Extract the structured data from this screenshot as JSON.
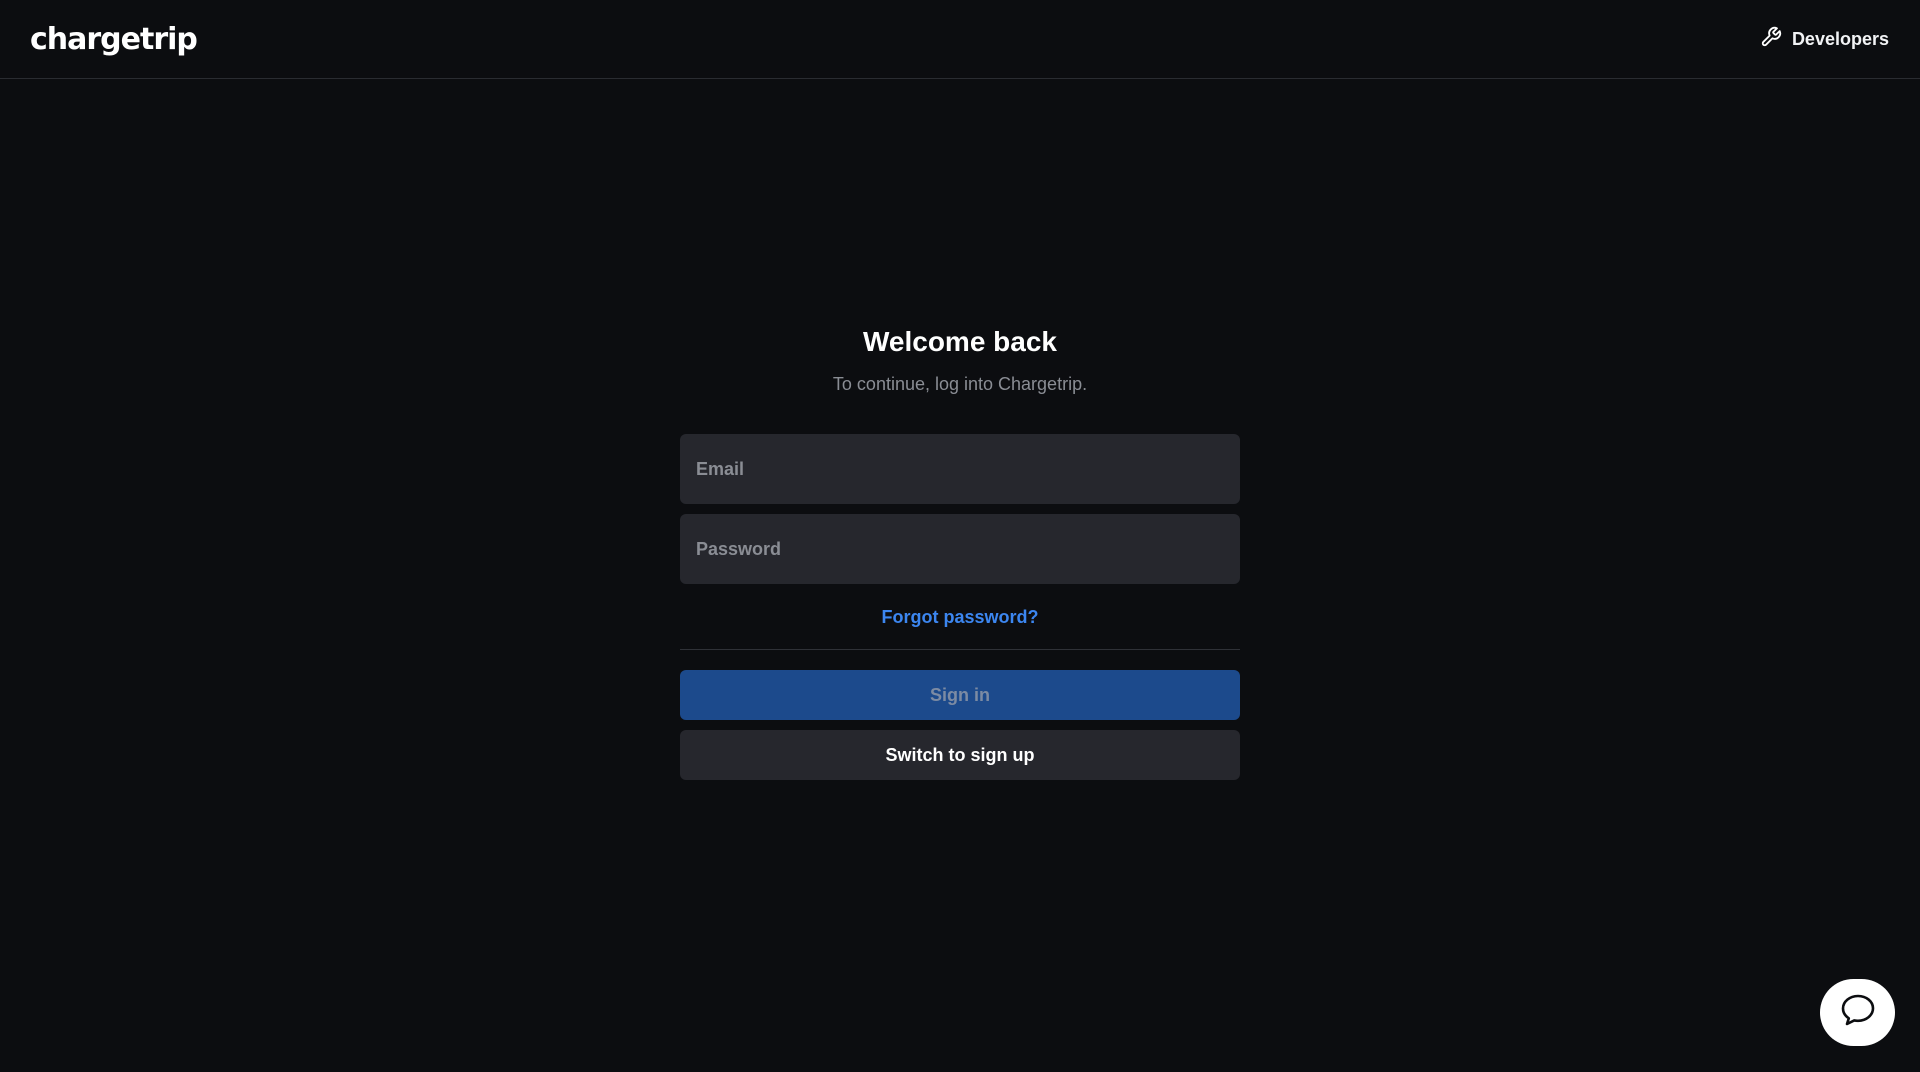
{
  "header": {
    "logo_text": "chargetrip",
    "developers_label": "Developers",
    "developers_icon": "wrench-icon"
  },
  "login": {
    "title": "Welcome back",
    "subtitle": "To continue, log into Chargetrip.",
    "email": {
      "value": "",
      "placeholder": "Email"
    },
    "password": {
      "value": "",
      "placeholder": "Password"
    },
    "forgot_label": "Forgot password?",
    "sign_in_label": "Sign in",
    "switch_label": "Switch to sign up"
  },
  "chat": {
    "icon": "chat-bubble-icon"
  },
  "colors": {
    "background": "#0c0d10",
    "field": "#26272d",
    "accent_link": "#3c86f0",
    "primary_button": "#1c4a8c"
  }
}
